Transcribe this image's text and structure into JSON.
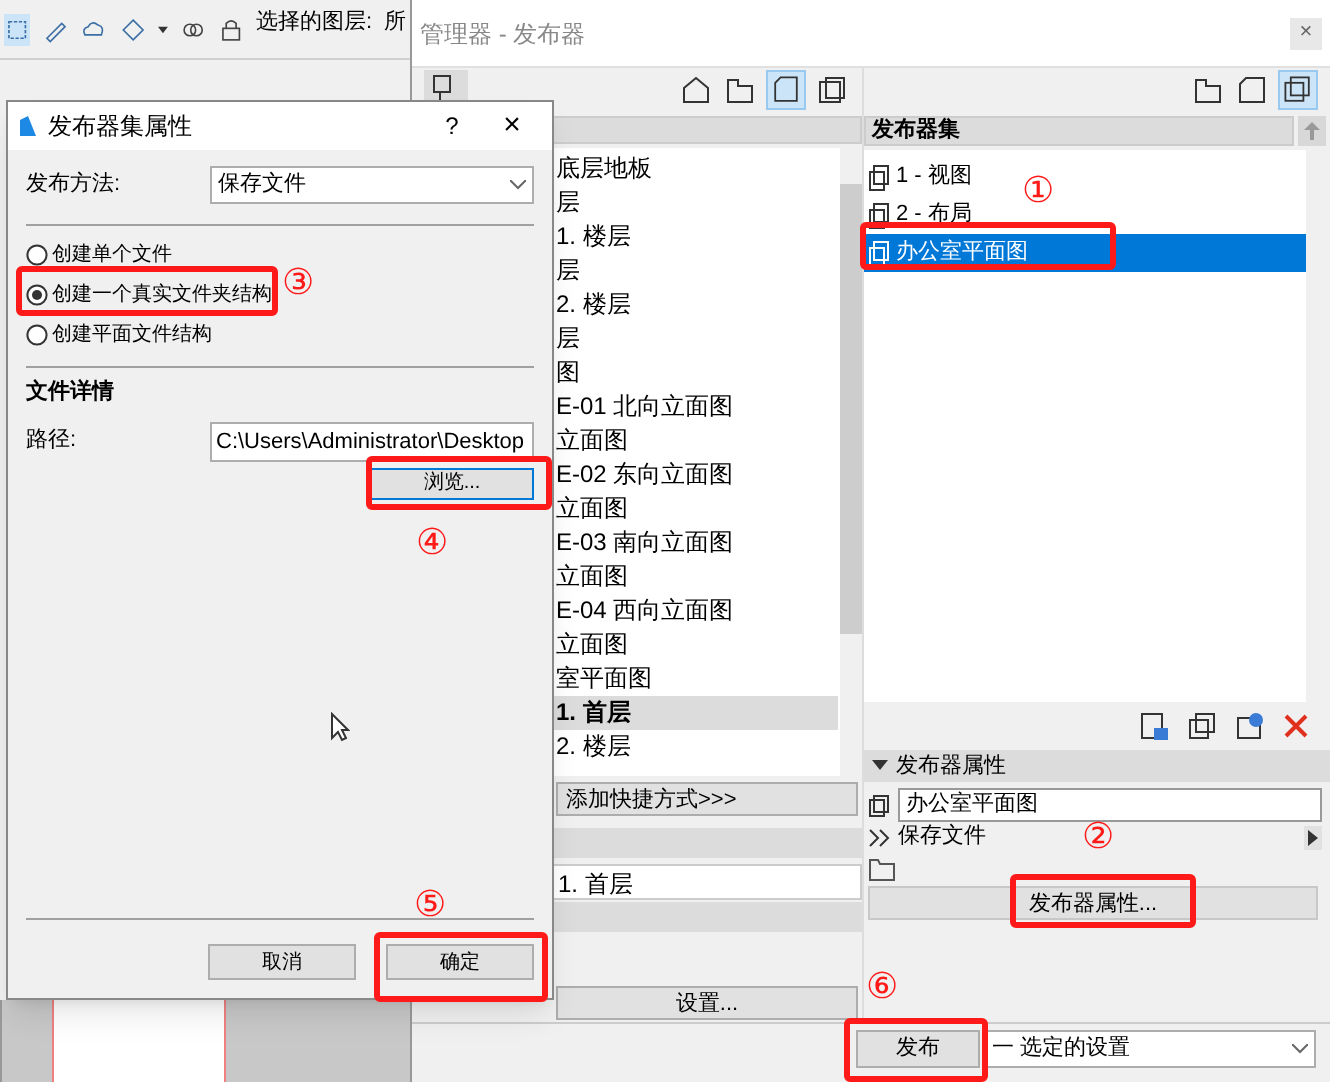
{
  "app_toolbar": {
    "layer_label": "选择的图层:",
    "cut_label": "所"
  },
  "organizer": {
    "title": "管理器 - 发布器",
    "close": "×",
    "view_tree": [
      {
        "label": "底层地板",
        "selected": false
      },
      {
        "label": "层",
        "selected": false
      },
      {
        "label": "1. 楼层",
        "selected": false
      },
      {
        "label": "层",
        "selected": false
      },
      {
        "label": "2. 楼层",
        "selected": false
      },
      {
        "label": "层",
        "selected": false
      },
      {
        "label": "图",
        "selected": false
      },
      {
        "label": "E-01 北向立面图",
        "selected": false
      },
      {
        "label": "立面图",
        "selected": false
      },
      {
        "label": "E-02 东向立面图",
        "selected": false
      },
      {
        "label": "立面图",
        "selected": false
      },
      {
        "label": "E-03 南向立面图",
        "selected": false
      },
      {
        "label": "立面图",
        "selected": false
      },
      {
        "label": "E-04 西向立面图",
        "selected": false
      },
      {
        "label": "立面图",
        "selected": false
      },
      {
        "label": "室平面图",
        "selected": false
      },
      {
        "label": "1. 首层",
        "selected": true
      },
      {
        "label": "2. 楼层",
        "selected": false
      }
    ],
    "add_shortcut_button": "添加快捷方式>>>",
    "selected_view_field": "1. 首层",
    "settings_button": "设置...",
    "publisher_sets": {
      "header": "发布器集",
      "items": [
        {
          "label": "1 - 视图",
          "selected": false
        },
        {
          "label": "2 - 布局",
          "selected": false
        },
        {
          "label": "办公室平面图",
          "selected": true
        }
      ]
    },
    "properties": {
      "header": "发布器属性",
      "expanded": true,
      "name": "办公室平面图",
      "method": "保存文件",
      "button": "发布器属性..."
    },
    "publish_button": "发布",
    "publish_scope": "一 选定的设置"
  },
  "dialog": {
    "title": "发布器集属性",
    "help": "?",
    "close": "×",
    "method_label": "发布方法:",
    "method_value": "保存文件",
    "options": [
      {
        "label": "创建单个文件",
        "selected": false
      },
      {
        "label": "创建一个真实文件夹结构",
        "selected": true
      },
      {
        "label": "创建平面文件结构",
        "selected": false
      }
    ],
    "details_heading": "文件详情",
    "path_label": "路径:",
    "path_value": "C:\\Users\\Administrator\\Desktop",
    "browse_button": "浏览...",
    "buttons": [
      "取消",
      "确定"
    ]
  },
  "annotations": [
    {
      "label": "①"
    },
    {
      "label": "②"
    },
    {
      "label": "③"
    },
    {
      "label": "④"
    },
    {
      "label": "⑤"
    },
    {
      "label": "⑥"
    }
  ]
}
